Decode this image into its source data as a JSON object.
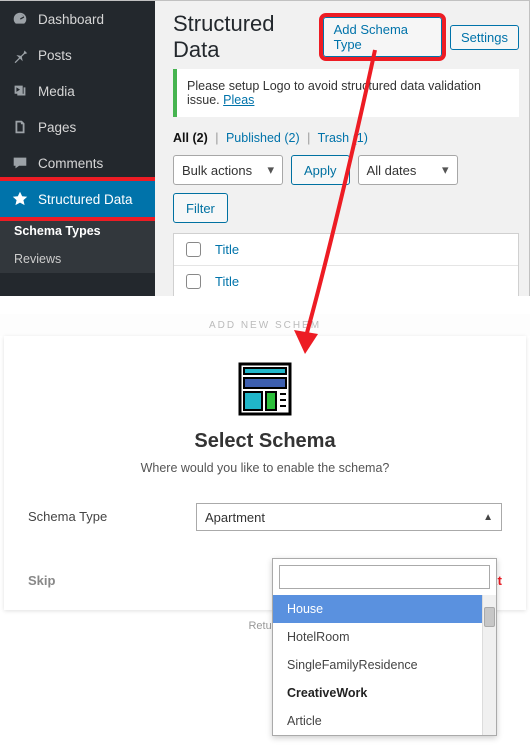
{
  "sidebar": {
    "items": [
      {
        "label": "Dashboard"
      },
      {
        "label": "Posts"
      },
      {
        "label": "Media"
      },
      {
        "label": "Pages"
      },
      {
        "label": "Comments"
      },
      {
        "label": "Structured Data"
      }
    ],
    "submenu": [
      {
        "label": "Schema Types"
      },
      {
        "label": "Reviews"
      }
    ]
  },
  "header": {
    "title": "Structured Data",
    "add_btn": "Add Schema Type",
    "settings_btn": "Settings"
  },
  "notice": {
    "text": "Please setup Logo to avoid structured data validation issue. ",
    "link": " Pleas"
  },
  "filters": {
    "all_label": "All",
    "all_count": "(2)",
    "published_label": "Published",
    "published_count": "(2)",
    "trash_label": "Trash",
    "trash_count": "(1)"
  },
  "toolbar": {
    "bulk_label": "Bulk actions",
    "apply_label": "Apply",
    "dates_label": "All dates",
    "filter_label": "Filter"
  },
  "table": {
    "col_title": "Title"
  },
  "crumb": "ADD NEW SCHEM",
  "schema": {
    "heading": "Select Schema",
    "sub": "Where would you like to enable the schema?",
    "row_label": "Schema Type",
    "value": "Apartment",
    "skip": "Skip",
    "next": "ext",
    "search_ph": ""
  },
  "dropdown": {
    "items": [
      {
        "label": "House",
        "sel": true
      },
      {
        "label": "HotelRoom"
      },
      {
        "label": "SingleFamilyResidence"
      },
      {
        "label": "CreativeWork",
        "group": true
      },
      {
        "label": "Article"
      }
    ]
  },
  "returns": "Return"
}
